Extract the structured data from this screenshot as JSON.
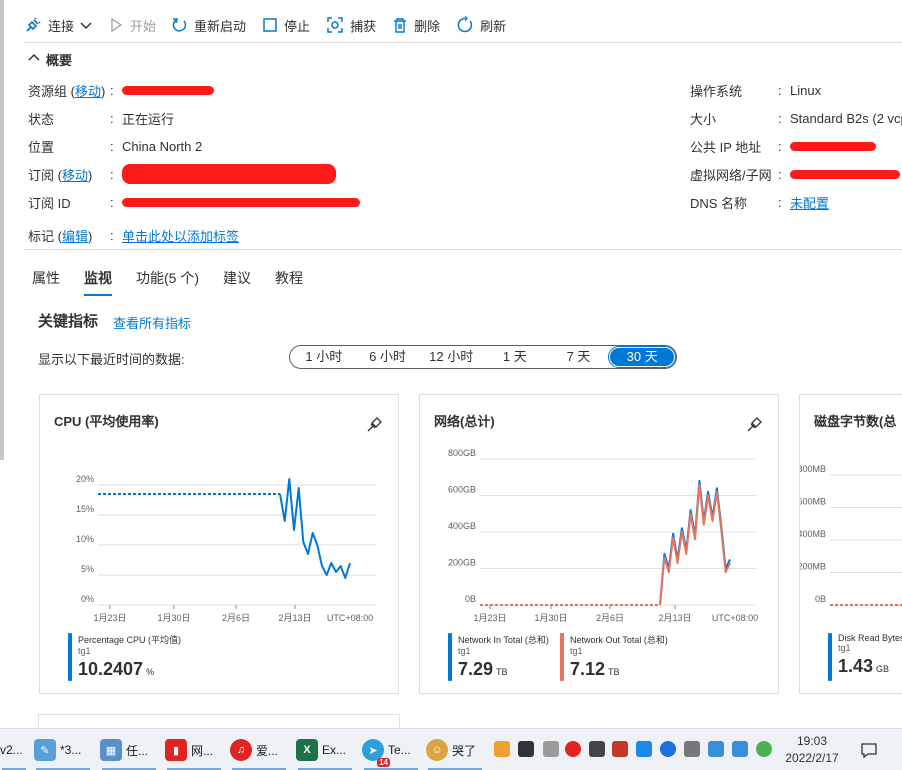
{
  "toolbar": {
    "connect": "连接",
    "start": "开始",
    "restart": "重新启动",
    "stop": "停止",
    "capture": "捕获",
    "delete": "删除",
    "refresh": "刷新"
  },
  "overview": {
    "title": "概要",
    "left": {
      "resource_group_label": "资源组",
      "move_link": "移动",
      "status_label": "状态",
      "status_value": "正在运行",
      "location_label": "位置",
      "location_value": "China North 2",
      "subscription_label": "订阅",
      "subscription_id_label": "订阅 ID",
      "tags_label": "标记",
      "edit_link": "编辑",
      "tags_value": "单击此处以添加标签"
    },
    "right": {
      "os_label": "操作系统",
      "os_value": "Linux",
      "size_label": "大小",
      "size_value": "Standard B2s (2 vcp",
      "public_ip_label": "公共 IP 地址",
      "vnet_label": "虚拟网络/子网",
      "dns_label": "DNS 名称",
      "dns_value": "未配置"
    }
  },
  "tabs": [
    "属性",
    "监视",
    "功能(5 个)",
    "建议",
    "教程"
  ],
  "active_tab": "监视",
  "metrics": {
    "title": "关键指标",
    "view_all": "查看所有指标",
    "range_label": "显示以下最近时间的数据:",
    "ranges": [
      "1 小时",
      "6 小时",
      "12 小时",
      "1 天",
      "7 天",
      "30 天"
    ],
    "selected_range": "30 天"
  },
  "chart_data": [
    {
      "type": "line",
      "title": "CPU (平均使用率)",
      "x_ticks": [
        "1月23日",
        "1月30日",
        "2月6日",
        "2月13日",
        "UTC+08:00"
      ],
      "y_ticks": [
        "20%",
        "15%",
        "10%",
        "5%",
        "0%"
      ],
      "ylim": [
        0,
        20
      ],
      "grid": true,
      "series": [
        {
          "name": "Percentage CPU (平均值)",
          "color": "#0078d4",
          "dashed_segment": {
            "from_date": "1月20日",
            "to_date": "2月10日",
            "value": 18.5
          },
          "values": [
            18.5,
            14.0,
            21.0,
            12.5,
            19.5,
            10.5,
            8.5,
            12.0,
            10.0,
            6.5,
            5.0,
            7.0,
            5.5,
            6.5,
            4.5,
            7.0
          ]
        }
      ],
      "legend": [
        {
          "name": "Percentage CPU (平均值)",
          "sub": "tg1",
          "value": "10.2407",
          "unit": "%",
          "color": "#0078d4"
        }
      ]
    },
    {
      "type": "line",
      "title": "网络(总计)",
      "x_ticks": [
        "1月23日",
        "1月30日",
        "2月6日",
        "2月13日",
        "UTC+08:00"
      ],
      "y_ticks": [
        "800GB",
        "600GB",
        "400GB",
        "200GB",
        "0B"
      ],
      "ylim": [
        0,
        800
      ],
      "grid": true,
      "series": [
        {
          "name": "Network In Total (总和)",
          "color": "#0078d4",
          "dashed_segment": {
            "from_date": "1月20日",
            "to_date": "2月10日",
            "value": 0
          },
          "values": [
            0,
            280,
            200,
            390,
            250,
            420,
            300,
            520,
            380,
            680,
            460,
            620,
            480,
            640,
            430,
            200,
            250
          ]
        },
        {
          "name": "Network Out Total (总和)",
          "color": "#e8745c",
          "dashed_segment": {
            "from_date": "1月20日",
            "to_date": "2月10日",
            "value": 0
          },
          "values": [
            0,
            260,
            180,
            370,
            230,
            400,
            280,
            500,
            360,
            660,
            440,
            600,
            460,
            620,
            410,
            180,
            230
          ]
        }
      ],
      "legend": [
        {
          "name": "Network In Total (总和)",
          "sub": "tg1",
          "value": "7.29",
          "unit": "TB",
          "color": "#0078d4"
        },
        {
          "name": "Network Out Total (总和)",
          "sub": "tg1",
          "value": "7.12",
          "unit": "TB",
          "color": "#e8745c"
        }
      ]
    },
    {
      "type": "line",
      "title": "磁盘字节数(总",
      "y_ticks": [
        "800MB",
        "600MB",
        "400MB",
        "200MB",
        "0B"
      ],
      "ylim": [
        0,
        800
      ],
      "grid": true,
      "series": [
        {
          "name": "Disk Read Bytes",
          "color": "#e8745c",
          "dashed_segment": {
            "value": 0
          },
          "values": []
        }
      ],
      "legend": [
        {
          "name": "Disk Read Bytes",
          "sub": "tg1",
          "value": "1.43",
          "unit": "GB",
          "color": "#0078d4"
        }
      ]
    }
  ],
  "taskbar": {
    "tasks": [
      {
        "label": "v2...",
        "icon": "v2ray-icon",
        "color": "#444444"
      },
      {
        "label": "*3...",
        "icon": "notepad-icon",
        "color": "#5aa0d8"
      },
      {
        "label": "任...",
        "icon": "task-manager-icon",
        "color": "#5b8fc9"
      },
      {
        "label": "网...",
        "icon": "netease-icon",
        "color": "#e02424"
      },
      {
        "label": "爱...",
        "icon": "music-icon",
        "color": "#e02424"
      },
      {
        "label": "Ex...",
        "icon": "excel-icon",
        "color": "#1e7145"
      },
      {
        "label": "Te...",
        "icon": "telegram-icon",
        "color": "#2aa1da",
        "badge": "14"
      },
      {
        "label": "哭了",
        "icon": "doge-icon",
        "color": "#d9a441"
      }
    ],
    "time": "19:03",
    "date": "2022/2/17"
  }
}
